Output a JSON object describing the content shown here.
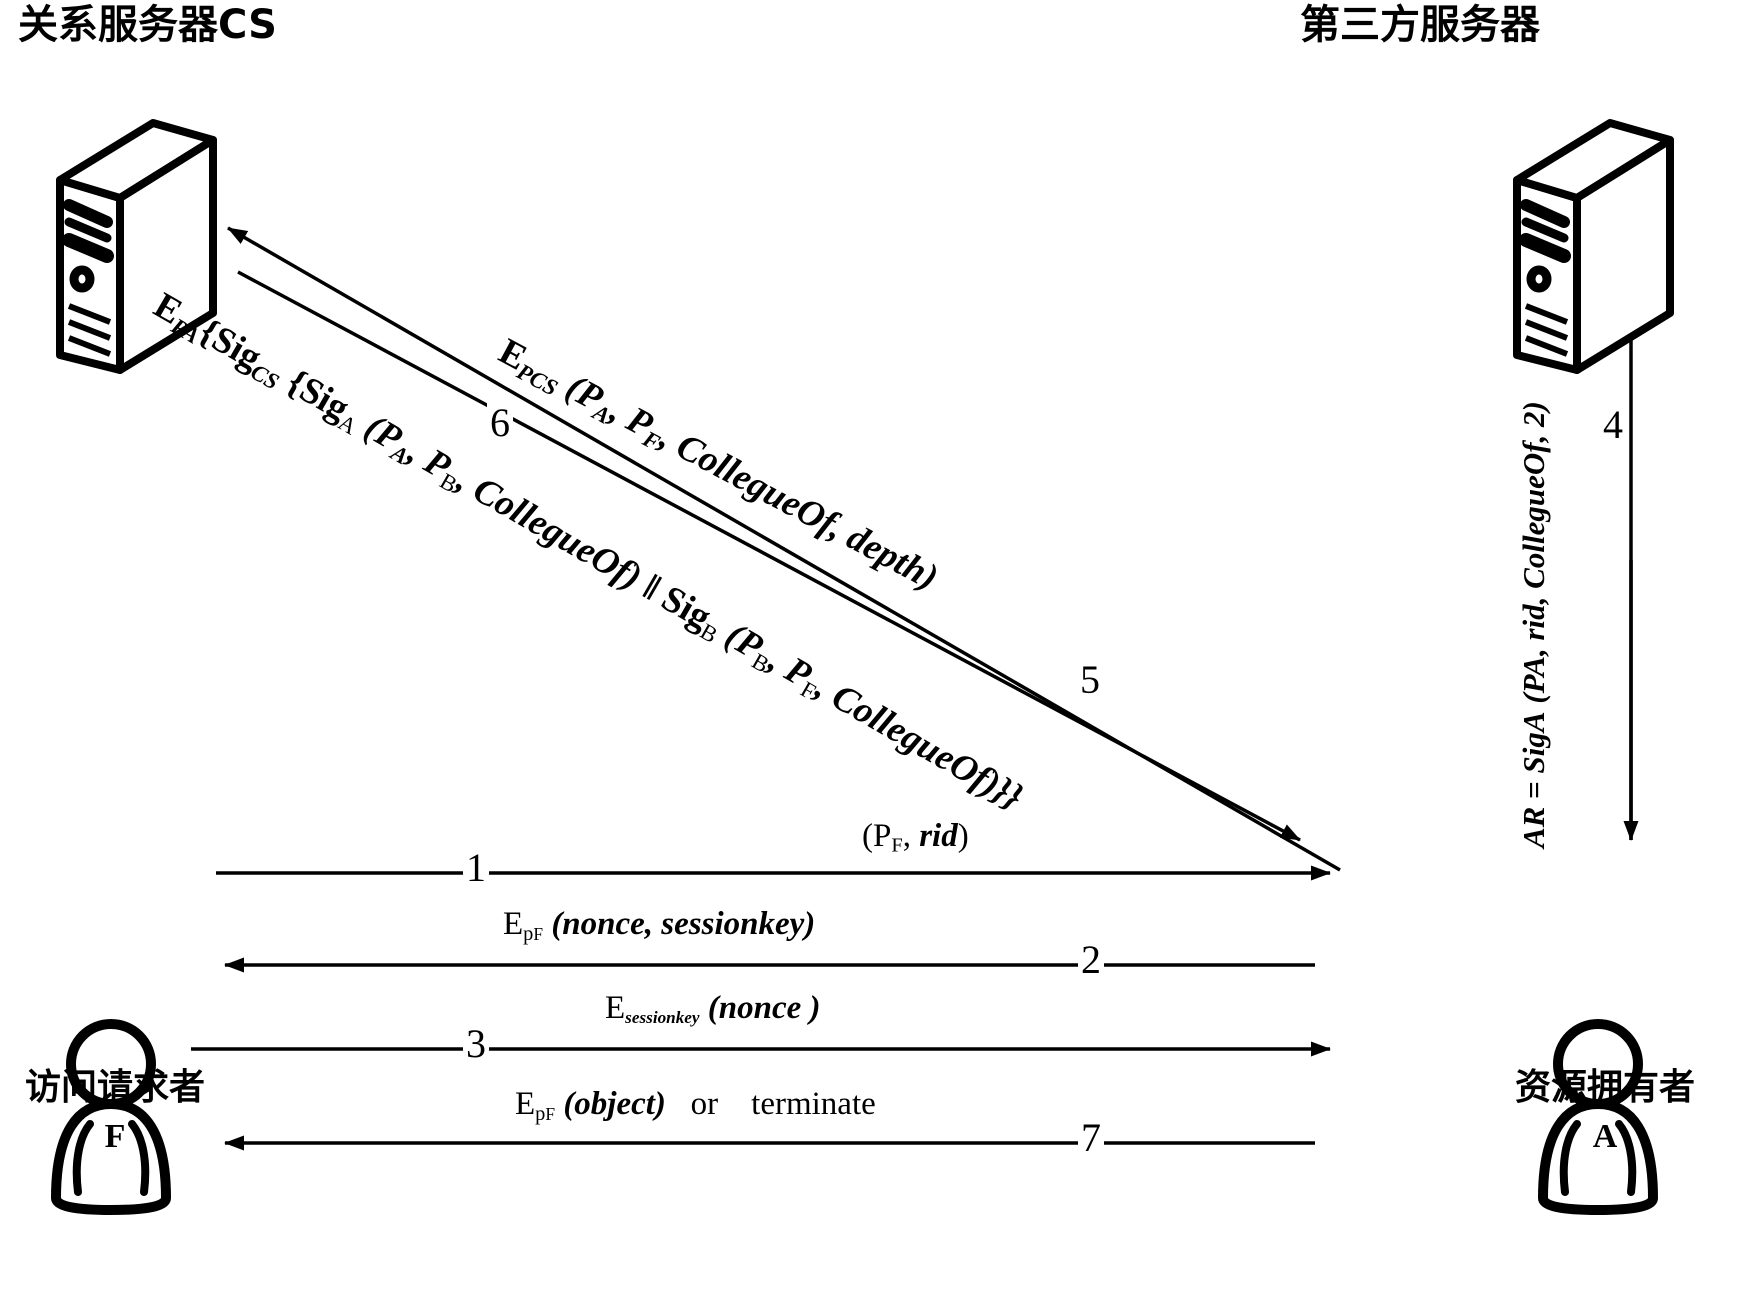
{
  "diagram": {
    "type": "protocol-sequence-diagram",
    "nodes": [
      {
        "id": "cs",
        "label": "关系服务器CS",
        "code": "",
        "icon": "server-icon"
      },
      {
        "id": "tps",
        "label": "第三方服务器",
        "code": "",
        "icon": "server-icon"
      },
      {
        "id": "f",
        "label": "访问请求者",
        "code": "F",
        "icon": "user-icon"
      },
      {
        "id": "a",
        "label": "资源拥有者",
        "code": "A",
        "icon": "user-icon"
      }
    ],
    "messages": [
      {
        "num": "1",
        "from": "f",
        "to": "a",
        "label_plain": "(P_F, rid)"
      },
      {
        "num": "2",
        "from": "a",
        "to": "f",
        "label_plain": "E_pF (nonce, sessionkey)"
      },
      {
        "num": "3",
        "from": "f",
        "to": "a",
        "label_plain": "E_sessionkey (nonce)"
      },
      {
        "num": "4",
        "from": "a",
        "to": "tps",
        "label_plain": "AR = Sig_A (P_A, rid, CollegueOf, 2)"
      },
      {
        "num": "5",
        "from": "cs",
        "to": "a",
        "label_plain": "E_PCS (P_A, P_F, CollegueOf, depth)"
      },
      {
        "num": "6",
        "from": "a",
        "to": "cs",
        "label_plain": "E_PA{Sig_CS {Sig_A (P_A, P_B, CollegueOf) || Sig_B (P_B, P_F, CollegueOf)}}"
      },
      {
        "num": "7",
        "from": "a",
        "to": "f",
        "label_plain": "E_pF (object)  or  terminate"
      }
    ],
    "colors": {
      "stroke": "#000000",
      "background": "#ffffff"
    }
  },
  "labels": {
    "cs_title": "关系服务器CS",
    "tps_title": "第三方服务器",
    "f_title": "访问请求者",
    "f_code": "F",
    "a_title": "资源拥有者",
    "a_code": "A",
    "num1": "1",
    "num2": "2",
    "num3": "3",
    "num4": "4",
    "num5": "5",
    "num6": "6",
    "num7": "7"
  }
}
